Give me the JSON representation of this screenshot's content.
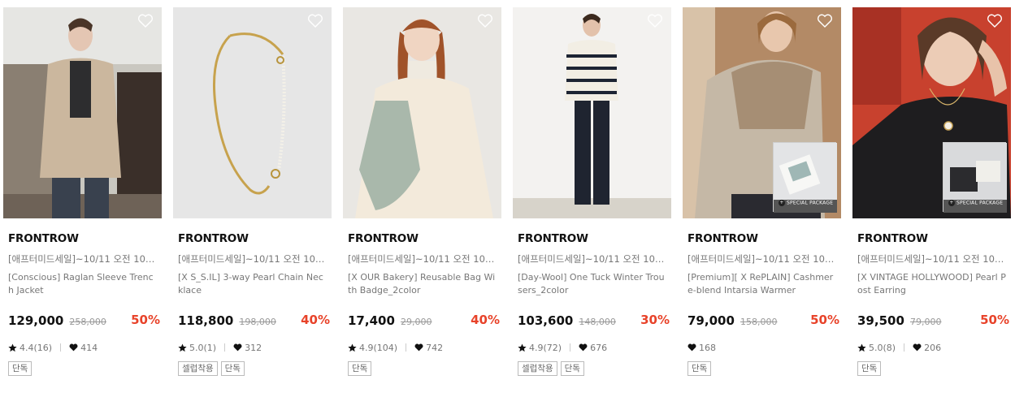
{
  "products": [
    {
      "brand": "FRONTROW",
      "promo": "[애프터미드세일]~10/11 오전 10시...",
      "name": "[Conscious] Raglan Sleeve Trench Jacket",
      "price": "129,000",
      "original_price": "258,000",
      "discount": "50%",
      "rating": "4.4(16)",
      "likes": "414",
      "tags": [
        "단독"
      ],
      "special_package": false
    },
    {
      "brand": "FRONTROW",
      "promo": "[애프터미드세일]~10/11 오전 10시...",
      "name": "[X S_S.IL] 3-way Pearl Chain Necklace",
      "price": "118,800",
      "original_price": "198,000",
      "discount": "40%",
      "rating": "5.0(1)",
      "likes": "312",
      "tags": [
        "셀럽착용",
        "단독"
      ],
      "special_package": false
    },
    {
      "brand": "FRONTROW",
      "promo": "[애프터미드세일]~10/11 오전 10시...",
      "name": "[X OUR Bakery] Reusable Bag With Badge_2color",
      "price": "17,400",
      "original_price": "29,000",
      "discount": "40%",
      "rating": "4.9(104)",
      "likes": "742",
      "tags": [
        "단독"
      ],
      "special_package": false
    },
    {
      "brand": "FRONTROW",
      "promo": "[애프터미드세일]~10/11 오전 10시...",
      "name": "[Day-Wool] One Tuck Winter Trousers_2color",
      "price": "103,600",
      "original_price": "148,000",
      "discount": "30%",
      "rating": "4.9(72)",
      "likes": "676",
      "tags": [
        "셀럽착용",
        "단독"
      ],
      "special_package": false
    },
    {
      "brand": "FRONTROW",
      "promo": "[애프터미드세일]~10/11 오전 10시...",
      "name": "[Premium][ X RePLAIN] Cashmere-blend Intarsia Warmer",
      "price": "79,000",
      "original_price": "158,000",
      "discount": "50%",
      "rating": "",
      "likes": "168",
      "tags": [
        "단독"
      ],
      "special_package": true
    },
    {
      "brand": "FRONTROW",
      "promo": "[애프터미드세일]~10/11 오전 10시...",
      "name": "[X VINTAGE HOLLYWOOD] Pearl Post Earring",
      "price": "39,500",
      "original_price": "79,000",
      "discount": "50%",
      "rating": "5.0(8)",
      "likes": "206",
      "tags": [
        "단독"
      ],
      "special_package": true
    }
  ],
  "special_package_label": "SPECIAL PACKAGE",
  "colors": {
    "discount": "#e8432a",
    "brand": "#111111",
    "muted": "#777777"
  },
  "icons": {
    "wishlist": "heart-outline-icon",
    "rating": "star-icon",
    "likes": "heart-filled-icon"
  }
}
